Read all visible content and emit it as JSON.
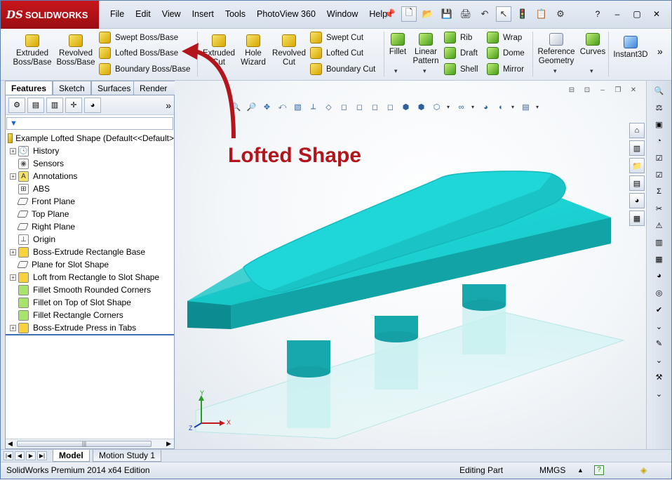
{
  "app": {
    "logo_text": "SOLIDWORKS",
    "logo_mark": "DS"
  },
  "menu": [
    "File",
    "Edit",
    "View",
    "Insert",
    "Tools",
    "PhotoView 360",
    "Window",
    "Help"
  ],
  "quick_access": [
    "pin-icon",
    "new-document-icon",
    "open-folder-icon",
    "save-icon",
    "print-icon",
    "undo-icon",
    "select-arrow-icon",
    "rebuild-icon",
    "file-properties-icon",
    "options-icon"
  ],
  "window_controls": [
    "?",
    "–",
    "▢",
    "✕"
  ],
  "commands": {
    "extruded_boss": "Extruded\nBoss/Base",
    "revolved_boss": "Revolved\nBoss/Base",
    "swept_boss": "Swept Boss/Base",
    "lofted_boss": "Lofted Boss/Base",
    "boundary_boss": "Boundary Boss/Base",
    "extruded_cut": "Extruded\nCut",
    "hole_wizard": "Hole\nWizard",
    "revolved_cut": "Revolved\nCut",
    "swept_cut": "Swept Cut",
    "lofted_cut": "Lofted Cut",
    "boundary_cut": "Boundary Cut",
    "fillet": "Fillet",
    "linear_pattern": "Linear\nPattern",
    "rib": "Rib",
    "draft": "Draft",
    "shell": "Shell",
    "wrap": "Wrap",
    "dome": "Dome",
    "mirror": "Mirror",
    "reference_geometry": "Reference\nGeometry",
    "curves": "Curves",
    "instant3d": "Instant3D",
    "more": "»"
  },
  "tabs": [
    "Features",
    "Sketch",
    "Surfaces",
    "Render Tools"
  ],
  "feature_manager": {
    "filter_icon": "filter-icon",
    "root": "Example Lofted Shape  (Default<<Default>",
    "items": [
      {
        "label": "History",
        "expandable": true,
        "icon": "history-icon"
      },
      {
        "label": "Sensors",
        "expandable": false,
        "icon": "sensor-icon"
      },
      {
        "label": "Annotations",
        "expandable": true,
        "icon": "annotations-icon"
      },
      {
        "label": "ABS",
        "expandable": false,
        "icon": "material-icon"
      },
      {
        "label": "Front Plane",
        "expandable": false,
        "icon": "plane-icon"
      },
      {
        "label": "Top Plane",
        "expandable": false,
        "icon": "plane-icon"
      },
      {
        "label": "Right Plane",
        "expandable": false,
        "icon": "plane-icon"
      },
      {
        "label": "Origin",
        "expandable": false,
        "icon": "origin-icon"
      },
      {
        "label": "Boss-Extrude Rectangle Base",
        "expandable": true,
        "icon": "extrude-icon"
      },
      {
        "label": "Plane for Slot Shape",
        "expandable": false,
        "icon": "plane-icon"
      },
      {
        "label": "Loft from Rectangle to Slot Shape",
        "expandable": true,
        "icon": "loft-icon"
      },
      {
        "label": "Fillet Smooth Rounded Corners",
        "expandable": false,
        "icon": "fillet-icon"
      },
      {
        "label": "Fillet on Top of Slot Shape",
        "expandable": false,
        "icon": "fillet-icon"
      },
      {
        "label": "Fillet Rectangle Corners",
        "expandable": false,
        "icon": "fillet-icon"
      },
      {
        "label": "Boss-Extrude Press in Tabs",
        "expandable": true,
        "icon": "extrude-icon"
      }
    ]
  },
  "viewport": {
    "callout": "Lofted Shape",
    "callout_color": "#b3151c",
    "model_color": "#17c1c4",
    "triad": {
      "x": "X",
      "y": "Y",
      "z": "Z"
    }
  },
  "bottom_tabs": [
    "Model",
    "Motion Study 1"
  ],
  "status": {
    "edition": "SolidWorks Premium 2014 x64 Edition",
    "mode": "Editing Part",
    "units": "MMGS",
    "units_dropdown": "▲"
  }
}
